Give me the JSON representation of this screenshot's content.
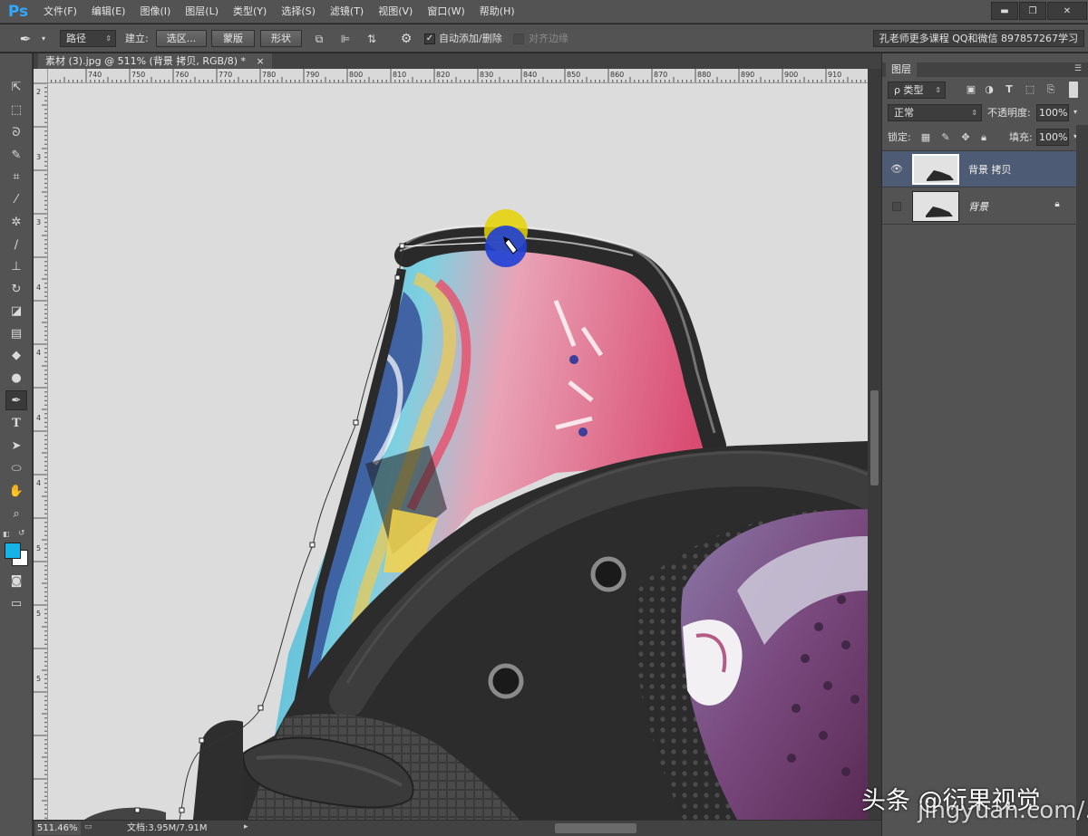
{
  "app": {
    "logo": "Ps"
  },
  "menu": [
    "文件(F)",
    "编辑(E)",
    "图像(I)",
    "图层(L)",
    "类型(Y)",
    "选择(S)",
    "滤镜(T)",
    "视图(V)",
    "窗口(W)",
    "帮助(H)"
  ],
  "window_controls": {
    "minimize": "▬",
    "restore": "❐",
    "close": "✕"
  },
  "options": {
    "mode": "路径",
    "build_label": "建立:",
    "selection_btn": "选区...",
    "mask_btn": "蒙版",
    "shape_btn": "形状",
    "auto_add_delete": "自动添加/删除",
    "auto_add_delete_checked": "✓",
    "align_edges": "对齐边缘",
    "promo": "孔老师更多课程 QQ和微信 897857267学习"
  },
  "document": {
    "tab": "素材 (3).jpg @ 511% (背景 拷贝, RGB/8) *",
    "tab_close": "×"
  },
  "ruler": {
    "top": [
      "740",
      "750",
      "760",
      "770",
      "780",
      "790",
      "800",
      "810",
      "820",
      "830",
      "840",
      "850",
      "860",
      "870",
      "880",
      "890",
      "900",
      "910"
    ],
    "left": [
      "2",
      "3",
      "3",
      "4",
      "4",
      "4",
      "4",
      "5",
      "5",
      "5"
    ]
  },
  "status": {
    "zoom": "511.46%",
    "doc_info": "文档:3.95M/7.91M"
  },
  "layers_panel": {
    "tab": "图层",
    "filter_kind": "ρ 类型",
    "blend_mode": "正常",
    "opacity_label": "不透明度:",
    "opacity_value": "100%",
    "lock_label": "锁定:",
    "fill_label": "填充:",
    "fill_value": "100%",
    "layers": [
      {
        "name": "背景 拷贝",
        "selected": true,
        "visible": true
      },
      {
        "name": "背景",
        "selected": false,
        "visible": false,
        "locked": true
      }
    ]
  },
  "watermark": {
    "text": "头条 @衍果视觉",
    "url": "jingyuan.com/..."
  },
  "colors": {
    "foreground": "#16b4e6",
    "background": "#ffffff",
    "selected_layer": "#4e5b74",
    "accent_ps": "#31a8ff"
  }
}
